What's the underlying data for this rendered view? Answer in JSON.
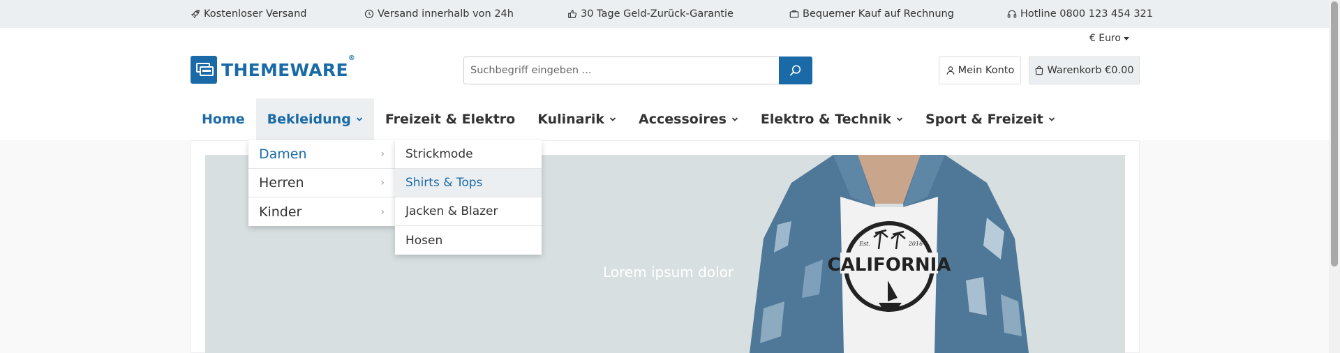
{
  "topbar": {
    "items": [
      {
        "icon": "rocket-icon",
        "label": "Kostenloser Versand"
      },
      {
        "icon": "clock-icon",
        "label": "Versand innerhalb von 24h"
      },
      {
        "icon": "thumbs-up-icon",
        "label": "30 Tage Geld-Zurück-Garantie"
      },
      {
        "icon": "briefcase-icon",
        "label": "Bequemer Kauf auf Rechnung"
      },
      {
        "icon": "headset-icon",
        "label": "Hotline 0800 123 454 321"
      }
    ]
  },
  "header": {
    "currency": "€ Euro",
    "logo_text": "THEMEWARE",
    "logo_reg": "®",
    "search_placeholder": "Suchbegriff eingeben ...",
    "account_label": "Mein Konto",
    "cart_label": "Warenkorb €0.00"
  },
  "nav": {
    "items": [
      {
        "label": "Home",
        "has_children": false
      },
      {
        "label": "Bekleidung",
        "has_children": true
      },
      {
        "label": "Freizeit & Elektro",
        "has_children": false
      },
      {
        "label": "Kulinarik",
        "has_children": true
      },
      {
        "label": "Accessoires",
        "has_children": true
      },
      {
        "label": "Elektro & Technik",
        "has_children": true
      },
      {
        "label": "Sport & Freizeit",
        "has_children": true
      }
    ]
  },
  "dropdown": {
    "level1": [
      {
        "label": "Damen",
        "arrow": "›"
      },
      {
        "label": "Herren",
        "arrow": "›"
      },
      {
        "label": "Kinder",
        "arrow": "›"
      }
    ],
    "level2": [
      {
        "label": "Strickmode"
      },
      {
        "label": "Shirts & Tops"
      },
      {
        "label": "Jacken & Blazer"
      },
      {
        "label": "Hosen"
      }
    ]
  },
  "hero": {
    "text": "Lorem ipsum dolor",
    "shirt_text": "CALIFORNIA",
    "shirt_est": "Est.",
    "shirt_year": "2016"
  },
  "colors": {
    "accent": "#1a6aa8",
    "topbar_bg": "#eceff1",
    "hero_bg": "#d8dfe0"
  }
}
